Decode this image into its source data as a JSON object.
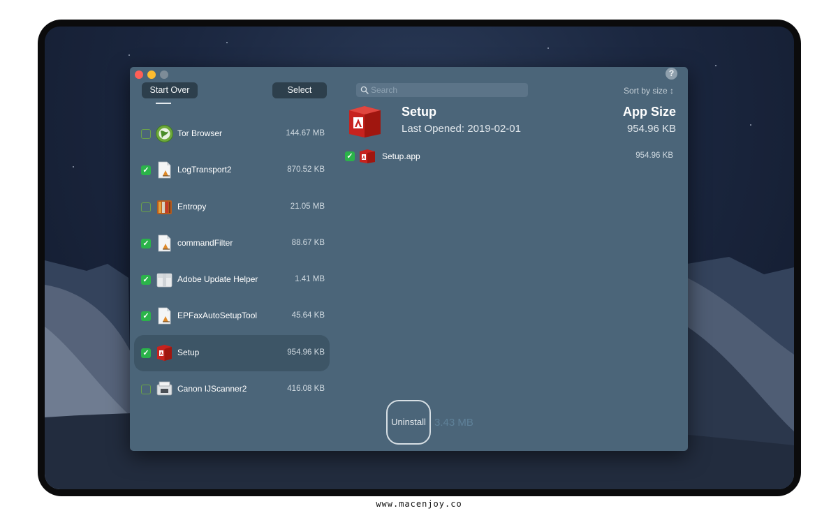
{
  "toolbar": {
    "start_over_label": "Start Over",
    "select_label": "Select",
    "help_label": "?"
  },
  "search": {
    "placeholder": "Search"
  },
  "sort": {
    "label": "Sort by size ↕"
  },
  "apps": [
    {
      "name": "Tor Browser",
      "size": "144.67 MB",
      "checked": false,
      "icon": "tor-globe-icon"
    },
    {
      "name": "LogTransport2",
      "size": "870.52 KB",
      "checked": true,
      "icon": "document-icon"
    },
    {
      "name": "Entropy",
      "size": "21.05 MB",
      "checked": false,
      "icon": "archive-books-icon"
    },
    {
      "name": "commandFilter",
      "size": "88.67 KB",
      "checked": true,
      "icon": "document-icon"
    },
    {
      "name": "Adobe Update Helper",
      "size": "1.41 MB",
      "checked": true,
      "icon": "package-box-icon"
    },
    {
      "name": "EPFaxAutoSetupTool",
      "size": "45.64 KB",
      "checked": true,
      "icon": "document-icon"
    },
    {
      "name": "Setup",
      "size": "954.96 KB",
      "checked": true,
      "selected": true,
      "icon": "adobe-box-icon"
    },
    {
      "name": "Canon IJScanner2",
      "size": "416.08 KB",
      "checked": false,
      "icon": "scanner-icon"
    }
  ],
  "detail": {
    "name": "Setup",
    "last_opened": "Last Opened: 2019-02-01",
    "size_label": "App Size",
    "size_value": "954.96 KB",
    "files": [
      {
        "name": "Setup.app",
        "size": "954.96 KB",
        "checked": true
      }
    ]
  },
  "footer": {
    "uninstall_label": "Uninstall",
    "total_size": "3.43 MB"
  },
  "watermark": "www.macenjoy.co",
  "colors": {
    "window_bg": "#4b6579",
    "selected_row": "#3d5566",
    "checkbox_on": "#2bb34a",
    "button_bg": "#2d3f4c"
  }
}
